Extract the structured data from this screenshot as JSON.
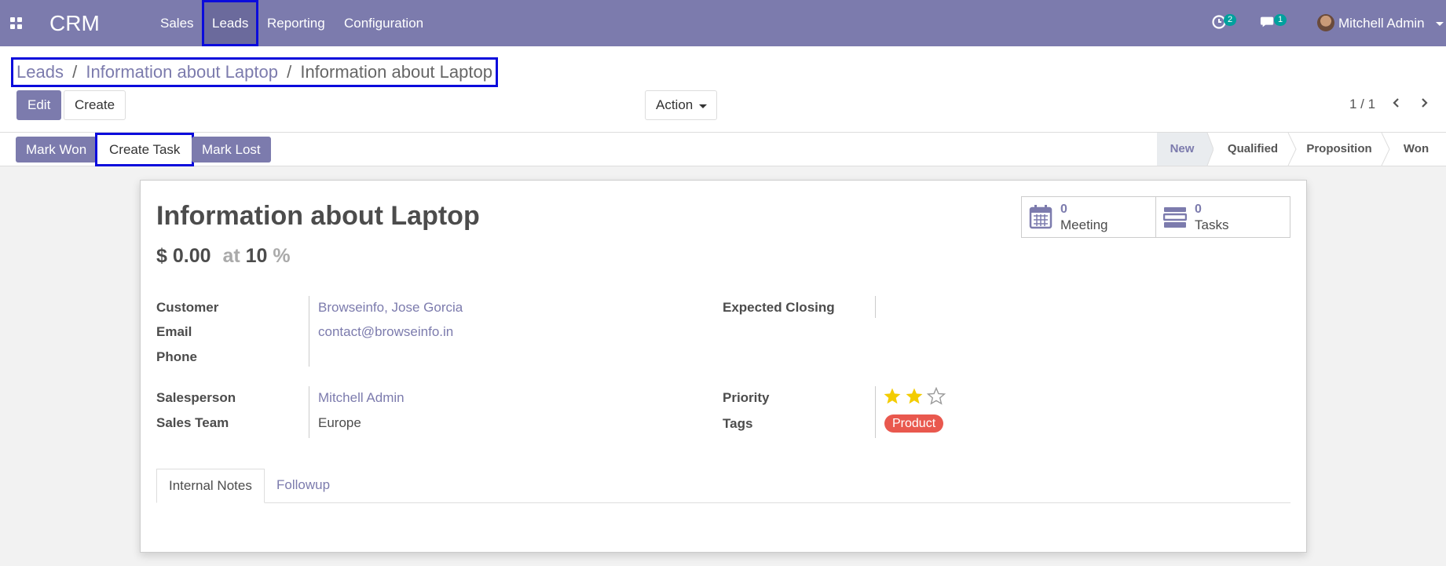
{
  "navbar": {
    "brand": "CRM",
    "menu": [
      "Sales",
      "Leads",
      "Reporting",
      "Configuration"
    ],
    "activity_count": "2",
    "message_count": "1",
    "user_name": "Mitchell Admin"
  },
  "breadcrumb": {
    "items": [
      "Leads",
      "Information about Laptop"
    ],
    "separator": "/",
    "current": "Information about Laptop"
  },
  "control": {
    "edit_label": "Edit",
    "create_label": "Create",
    "action_label": "Action",
    "pager": "1 / 1"
  },
  "statusbar": {
    "buttons": [
      "Mark Won",
      "Create Task",
      "Mark Lost"
    ],
    "stages": [
      "New",
      "Qualified",
      "Proposition",
      "Won"
    ],
    "active_stage": "New"
  },
  "form": {
    "title": "Information about Laptop",
    "revenue": "$ 0.00",
    "at_label": "at",
    "probability": "10",
    "percent": "%",
    "stats": [
      {
        "count": "0",
        "label": "Meeting",
        "icon": "calendar-icon"
      },
      {
        "count": "0",
        "label": "Tasks",
        "icon": "tasks-icon"
      }
    ],
    "fields_left": [
      {
        "label": "Customer",
        "value": "Browseinfo, Jose Gorcia"
      },
      {
        "label": "Email",
        "value": "contact@browseinfo.in"
      },
      {
        "label": "Phone",
        "value": ""
      },
      {
        "label": "Salesperson",
        "value": "Mitchell Admin"
      },
      {
        "label": "Sales Team",
        "value": "Europe"
      }
    ],
    "fields_right": [
      {
        "label": "Expected Closing",
        "value": ""
      },
      {
        "label": "Priority",
        "value": ""
      },
      {
        "label": "Tags",
        "value": "Product"
      }
    ],
    "priority_stars": 2,
    "priority_max": 3,
    "tabs": [
      "Internal Notes",
      "Followup"
    ]
  },
  "colors": {
    "brand": "#7c7bad",
    "highlight": "#0b0bdc",
    "tag": "#e9584e",
    "star": "#f3cc00",
    "badge": "#00a09d"
  }
}
